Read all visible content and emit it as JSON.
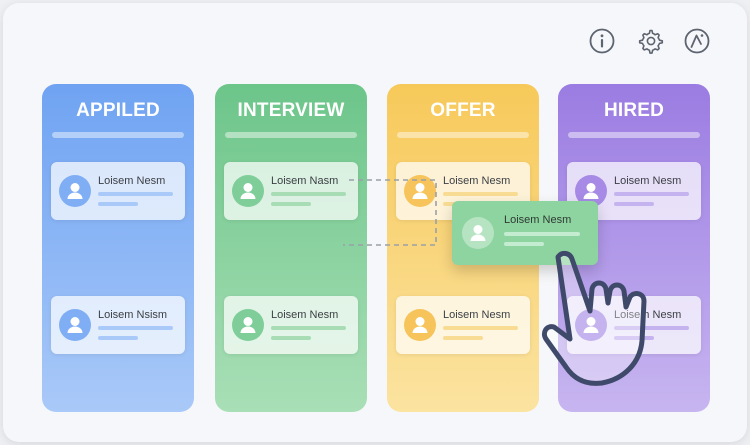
{
  "toolbar": {
    "buttons": [
      {
        "icon": "info-icon"
      },
      {
        "icon": "gear-icon"
      },
      {
        "icon": "edit-icon"
      }
    ]
  },
  "columns": [
    {
      "title": "APPILED",
      "color": "#6fa3f2",
      "cards": [
        {
          "name": "Loisem Nesm"
        },
        {
          "name": "Loisem Nsism"
        }
      ]
    },
    {
      "title": "INTERVIEW",
      "color": "#6cc58a",
      "cards": [
        {
          "name": "Loisem Nasm"
        },
        {
          "name": "Loisem Nesm"
        }
      ]
    },
    {
      "title": "OFFER",
      "color": "#f7c95a",
      "cards": [
        {
          "name": "Loisem Nesm"
        },
        {
          "name": "Loisem Nesm"
        }
      ]
    },
    {
      "title": "HIRED",
      "color": "#9b7ce2",
      "cards": [
        {
          "name": "Loisem Nesm"
        },
        {
          "name": "Loisem Nesm"
        }
      ]
    }
  ],
  "dragged_card": {
    "name": "Loisem Nesm",
    "color": "#8ed4a0"
  },
  "cursor": {
    "icon": "hand-pointer-icon"
  }
}
